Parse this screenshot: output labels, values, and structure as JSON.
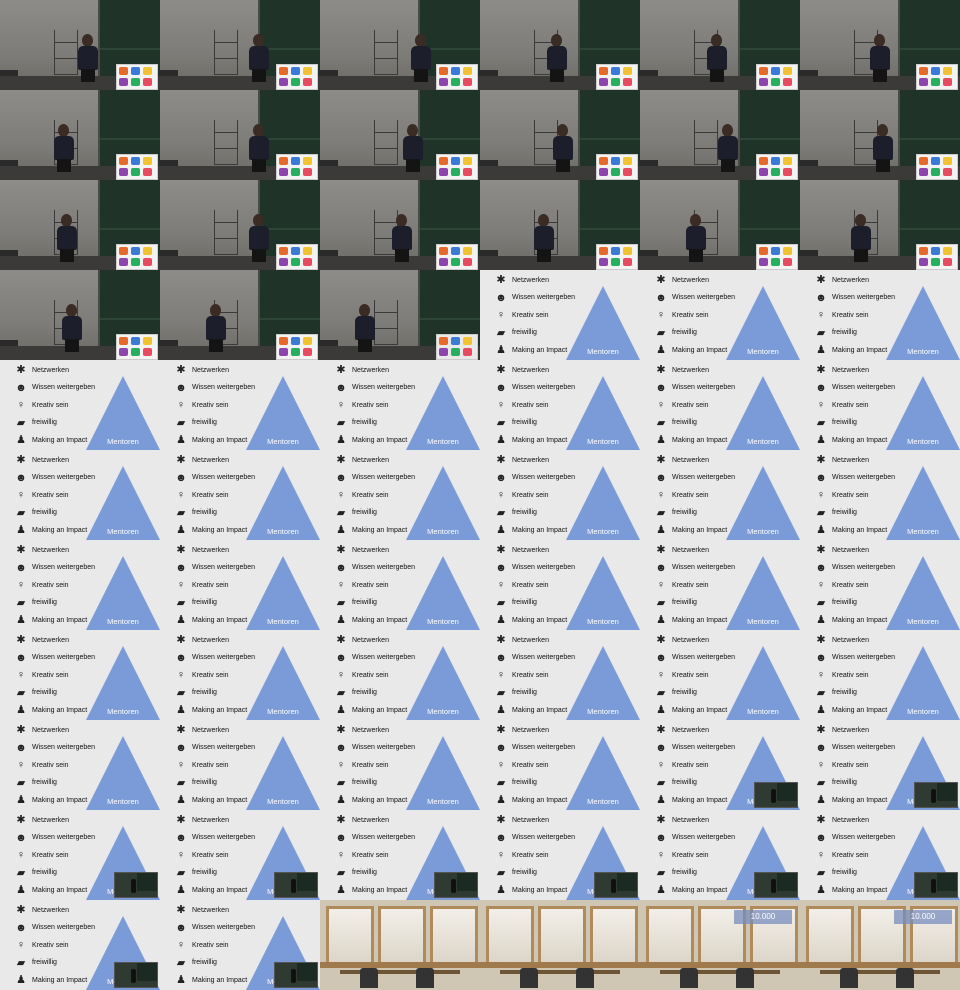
{
  "slide": {
    "items": [
      {
        "icon": "network-icon",
        "glyph": "✱",
        "label": "Netzwerken"
      },
      {
        "icon": "head-gears-icon",
        "glyph": "☻",
        "label": "Wissen weitergeben"
      },
      {
        "icon": "lightbulb-icon",
        "glyph": "♀",
        "label": "Kreativ sein"
      },
      {
        "icon": "hand-heart-icon",
        "glyph": "▰",
        "label": "freiwillig"
      },
      {
        "icon": "crowd-icon",
        "glyph": "♟",
        "label": "Making an Impact"
      }
    ],
    "pyramid_label": "Mentoren",
    "pyramid_color": "#7a9ad8"
  },
  "counter_text": "10.000",
  "frames": [
    {
      "type": "hall",
      "x": 0.55
    },
    {
      "type": "hall",
      "x": 0.62
    },
    {
      "type": "hall",
      "x": 0.63
    },
    {
      "type": "hall",
      "x": 0.48
    },
    {
      "type": "hall",
      "x": 0.48
    },
    {
      "type": "hall",
      "x": 0.5
    },
    {
      "type": "hall",
      "x": 0.4
    },
    {
      "type": "hall",
      "x": 0.62
    },
    {
      "type": "hall",
      "x": 0.58
    },
    {
      "type": "hall",
      "x": 0.52
    },
    {
      "type": "hall",
      "x": 0.55
    },
    {
      "type": "hall",
      "x": 0.52
    },
    {
      "type": "hall",
      "x": 0.42
    },
    {
      "type": "hall",
      "x": 0.62
    },
    {
      "type": "hall",
      "x": 0.51
    },
    {
      "type": "hall",
      "x": 0.4
    },
    {
      "type": "hall",
      "x": 0.35
    },
    {
      "type": "hall",
      "x": 0.38
    },
    {
      "type": "hall",
      "x": 0.45
    },
    {
      "type": "hall",
      "x": 0.35
    },
    {
      "type": "hall-slide",
      "x": 0.28
    },
    {
      "type": "slide"
    },
    {
      "type": "slide"
    },
    {
      "type": "slide"
    },
    {
      "type": "slide"
    },
    {
      "type": "slide"
    },
    {
      "type": "slide"
    },
    {
      "type": "slide"
    },
    {
      "type": "slide"
    },
    {
      "type": "slide"
    },
    {
      "type": "slide"
    },
    {
      "type": "slide"
    },
    {
      "type": "slide"
    },
    {
      "type": "slide"
    },
    {
      "type": "slide"
    },
    {
      "type": "slide"
    },
    {
      "type": "slide"
    },
    {
      "type": "slide"
    },
    {
      "type": "slide"
    },
    {
      "type": "slide"
    },
    {
      "type": "slide"
    },
    {
      "type": "slide"
    },
    {
      "type": "slide"
    },
    {
      "type": "slide"
    },
    {
      "type": "slide"
    },
    {
      "type": "slide"
    },
    {
      "type": "slide"
    },
    {
      "type": "slide"
    },
    {
      "type": "slide"
    },
    {
      "type": "slide"
    },
    {
      "type": "slide"
    },
    {
      "type": "slide"
    },
    {
      "type": "slide-pip"
    },
    {
      "type": "slide-pip"
    },
    {
      "type": "slide-pip"
    },
    {
      "type": "slide-pip"
    },
    {
      "type": "slide-pip"
    },
    {
      "type": "slide-pip"
    },
    {
      "type": "slide-pip"
    },
    {
      "type": "slide-pip"
    },
    {
      "type": "slide-pip"
    },
    {
      "type": "slide-pip"
    },
    {
      "type": "window"
    },
    {
      "type": "window"
    },
    {
      "type": "window-counter"
    },
    {
      "type": "window-counter"
    }
  ]
}
